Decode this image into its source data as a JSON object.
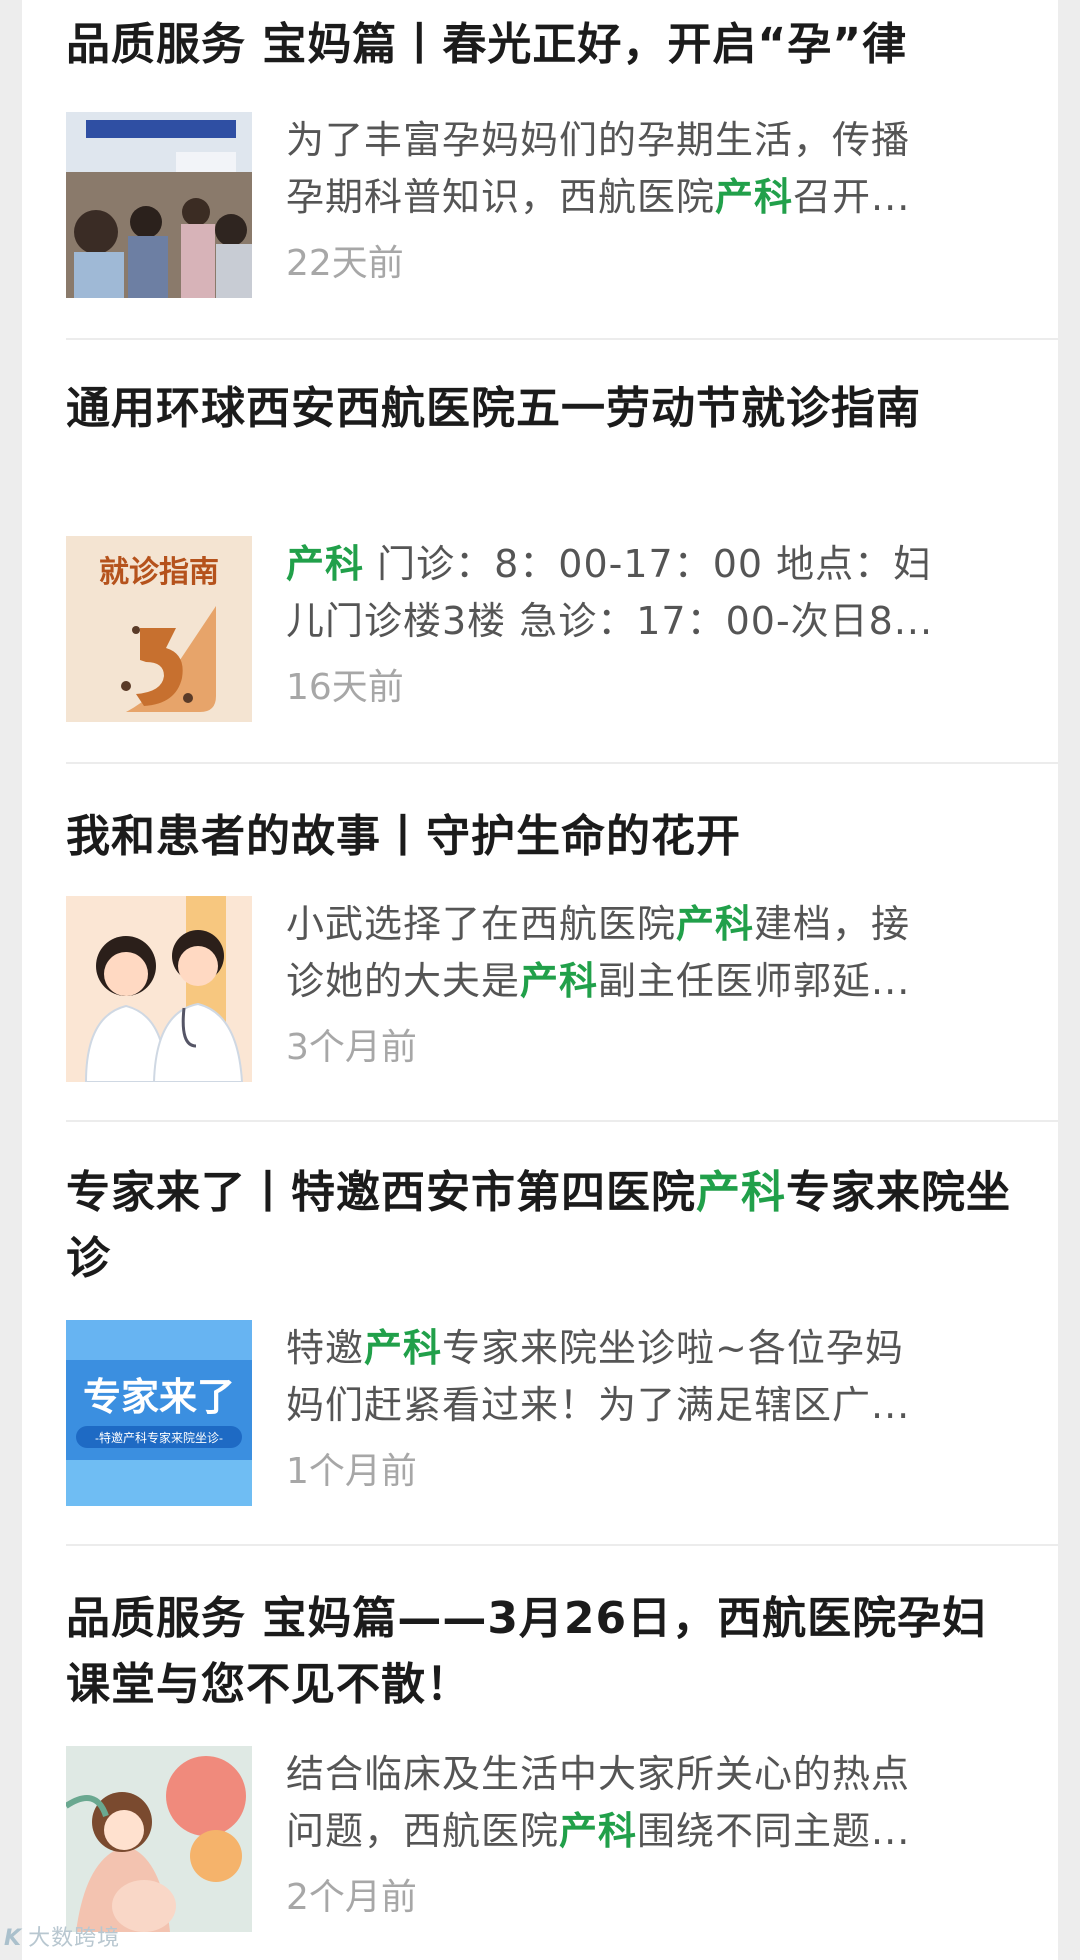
{
  "articles": [
    {
      "title": "品质服务 宝妈篇丨春光正好，开启“孕”律",
      "summary_lines": [
        [
          "为了丰富孕妈妈们的孕期生活，传播"
        ],
        [
          "孕期科普知识，西航医院",
          "产科",
          "召开..."
        ]
      ],
      "time": "22天前",
      "thumb": {
        "icon": "classroom-photo-icon"
      }
    },
    {
      "title": "通用环球西安西航医院五一劳动节就诊指南",
      "summary_lines": [
        [
          "",
          "产科",
          " 门诊：8：00-17：00 地点：妇"
        ],
        [
          "儿门诊楼3楼 急诊：17：00-次日8..."
        ]
      ],
      "time": "16天前",
      "thumb": {
        "icon": "visit-guide-poster-icon",
        "text": "就诊指南"
      }
    },
    {
      "title": "我和患者的故事丨守护生命的花开",
      "summary_lines": [
        [
          "小武选择了在西航医院",
          "产科",
          "建档，接"
        ],
        [
          "诊她的大夫是",
          "产科",
          "副主任医师郭延..."
        ]
      ],
      "time": "3个月前",
      "thumb": {
        "icon": "doctors-illustration-icon"
      }
    },
    {
      "title_parts": [
        "专家来了丨特邀西安市第四医院",
        "产科",
        "专家来院坐诊"
      ],
      "summary_lines": [
        [
          "特邀",
          "产科",
          "专家来院坐诊啦~各位孕妈"
        ],
        [
          "妈们赶紧看过来！为了满足辖区广..."
        ]
      ],
      "time": "1个月前",
      "thumb": {
        "icon": "expert-banner-icon",
        "text": "专家来了",
        "subtext": "-特邀产科专家来院坐诊-"
      }
    },
    {
      "title": "品质服务 宝妈篇——3月26日，西航医院孕妇课堂与您不见不散！",
      "summary_lines": [
        [
          "结合临床及生活中大家所关心的热点"
        ],
        [
          "问题，西航医院",
          "产科",
          "围绕不同主题..."
        ]
      ],
      "time": "2个月前",
      "thumb": {
        "icon": "pregnant-woman-illustration-icon"
      }
    }
  ],
  "watermark": {
    "logo": "K",
    "text": "大数跨境"
  },
  "colors": {
    "highlight": "#21a04a",
    "title": "#1b1b1b",
    "time": "#a7a7a7"
  }
}
